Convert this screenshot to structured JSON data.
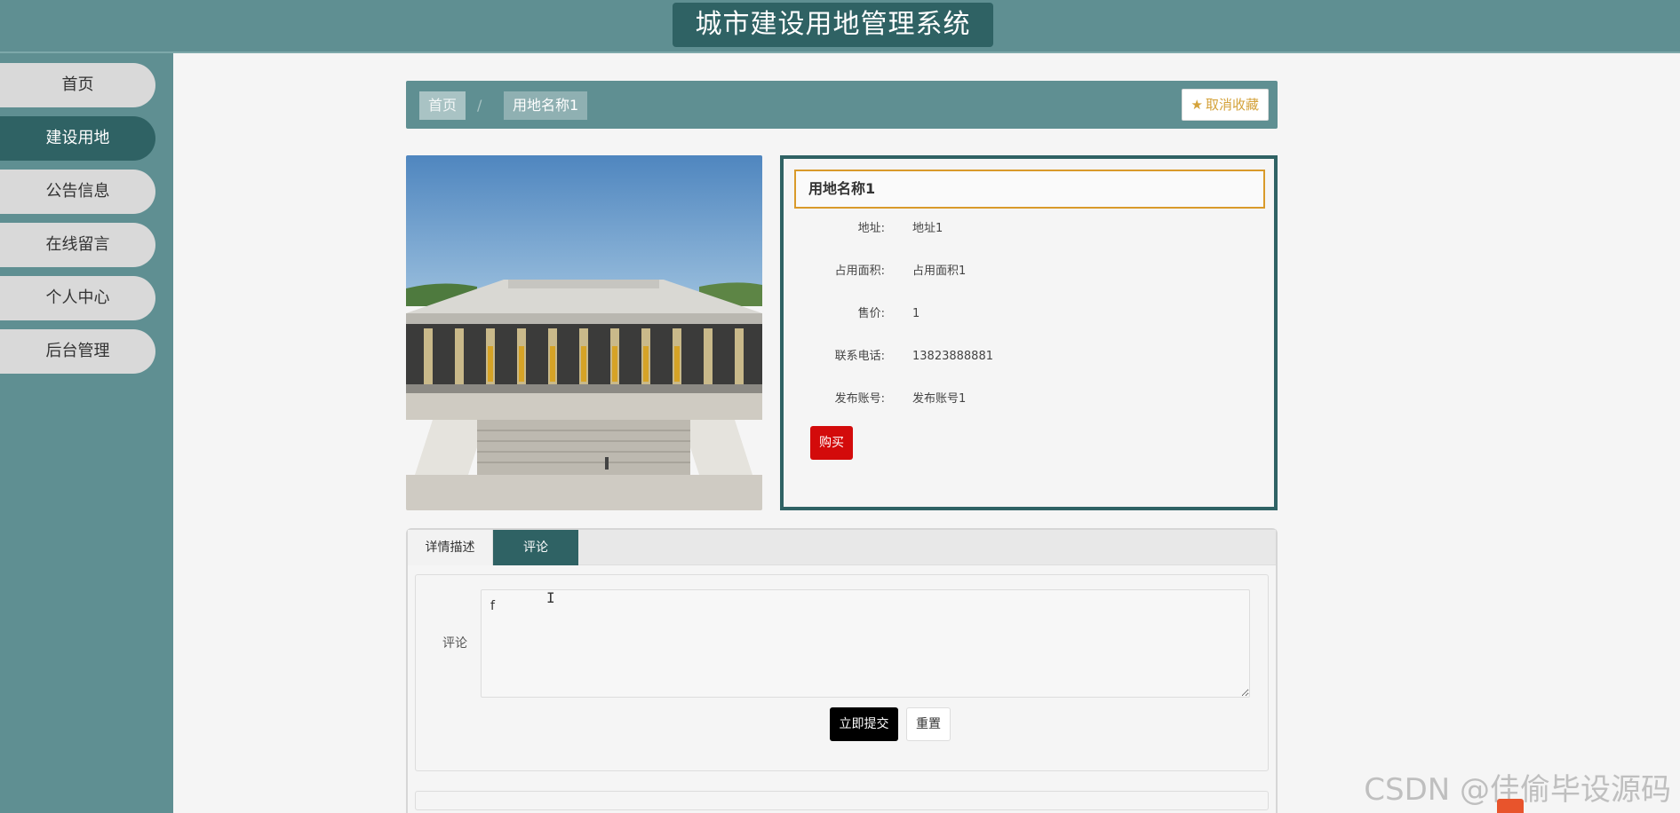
{
  "header": {
    "title": "城市建设用地管理系统"
  },
  "sidebar": {
    "items": [
      {
        "label": "首页",
        "active": false
      },
      {
        "label": "建设用地",
        "active": true
      },
      {
        "label": "公告信息",
        "active": false
      },
      {
        "label": "在线留言",
        "active": false
      },
      {
        "label": "个人中心",
        "active": false
      },
      {
        "label": "后台管理",
        "active": false
      }
    ]
  },
  "breadcrumb": {
    "home": "首页",
    "separator": "/",
    "current": "用地名称1"
  },
  "actions": {
    "favorite_label": "取消收藏"
  },
  "detail": {
    "title": "用地名称1",
    "fields": [
      {
        "label": "地址:",
        "value": "地址1"
      },
      {
        "label": "占用面积:",
        "value": "占用面积1"
      },
      {
        "label": "售价:",
        "value": "1"
      },
      {
        "label": "联系电话:",
        "value": "13823888881"
      },
      {
        "label": "发布账号:",
        "value": "发布账号1"
      }
    ],
    "buy_label": "购买"
  },
  "tabs": [
    {
      "label": "详情描述",
      "active": false
    },
    {
      "label": "评论",
      "active": true
    }
  ],
  "comment_form": {
    "label": "评论",
    "value": "f",
    "submit_label": "立即提交",
    "reset_label": "重置"
  },
  "watermark": "CSDN @佳偷毕设源码",
  "colors": {
    "primary": "#5f8f92",
    "dark": "#2f6264",
    "buy": "#d30b0b",
    "accent": "#d99a2a"
  }
}
